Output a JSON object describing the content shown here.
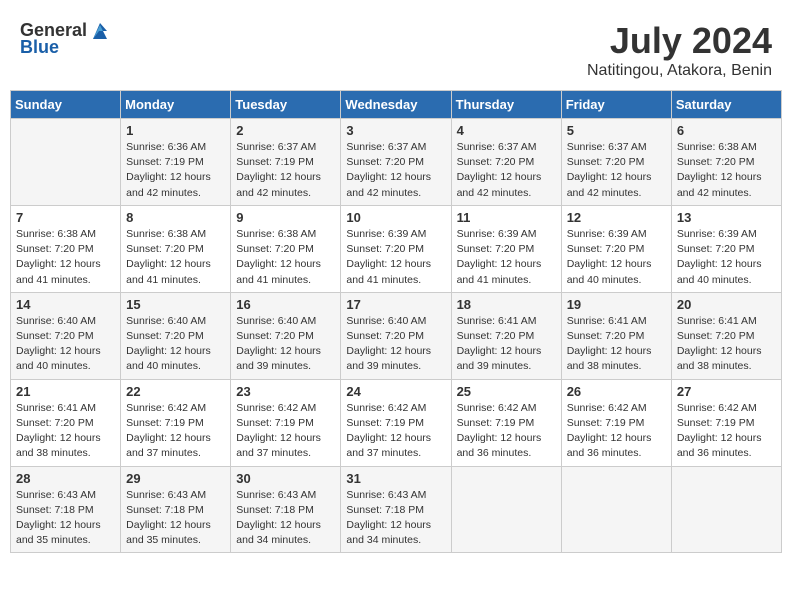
{
  "header": {
    "logo_general": "General",
    "logo_blue": "Blue",
    "title": "July 2024",
    "subtitle": "Natitingou, Atakora, Benin"
  },
  "weekdays": [
    "Sunday",
    "Monday",
    "Tuesday",
    "Wednesday",
    "Thursday",
    "Friday",
    "Saturday"
  ],
  "weeks": [
    [
      {
        "day": "",
        "info": ""
      },
      {
        "day": "1",
        "info": "Sunrise: 6:36 AM\nSunset: 7:19 PM\nDaylight: 12 hours\nand 42 minutes."
      },
      {
        "day": "2",
        "info": "Sunrise: 6:37 AM\nSunset: 7:19 PM\nDaylight: 12 hours\nand 42 minutes."
      },
      {
        "day": "3",
        "info": "Sunrise: 6:37 AM\nSunset: 7:20 PM\nDaylight: 12 hours\nand 42 minutes."
      },
      {
        "day": "4",
        "info": "Sunrise: 6:37 AM\nSunset: 7:20 PM\nDaylight: 12 hours\nand 42 minutes."
      },
      {
        "day": "5",
        "info": "Sunrise: 6:37 AM\nSunset: 7:20 PM\nDaylight: 12 hours\nand 42 minutes."
      },
      {
        "day": "6",
        "info": "Sunrise: 6:38 AM\nSunset: 7:20 PM\nDaylight: 12 hours\nand 42 minutes."
      }
    ],
    [
      {
        "day": "7",
        "info": "Sunrise: 6:38 AM\nSunset: 7:20 PM\nDaylight: 12 hours\nand 41 minutes."
      },
      {
        "day": "8",
        "info": "Sunrise: 6:38 AM\nSunset: 7:20 PM\nDaylight: 12 hours\nand 41 minutes."
      },
      {
        "day": "9",
        "info": "Sunrise: 6:38 AM\nSunset: 7:20 PM\nDaylight: 12 hours\nand 41 minutes."
      },
      {
        "day": "10",
        "info": "Sunrise: 6:39 AM\nSunset: 7:20 PM\nDaylight: 12 hours\nand 41 minutes."
      },
      {
        "day": "11",
        "info": "Sunrise: 6:39 AM\nSunset: 7:20 PM\nDaylight: 12 hours\nand 41 minutes."
      },
      {
        "day": "12",
        "info": "Sunrise: 6:39 AM\nSunset: 7:20 PM\nDaylight: 12 hours\nand 40 minutes."
      },
      {
        "day": "13",
        "info": "Sunrise: 6:39 AM\nSunset: 7:20 PM\nDaylight: 12 hours\nand 40 minutes."
      }
    ],
    [
      {
        "day": "14",
        "info": "Sunrise: 6:40 AM\nSunset: 7:20 PM\nDaylight: 12 hours\nand 40 minutes."
      },
      {
        "day": "15",
        "info": "Sunrise: 6:40 AM\nSunset: 7:20 PM\nDaylight: 12 hours\nand 40 minutes."
      },
      {
        "day": "16",
        "info": "Sunrise: 6:40 AM\nSunset: 7:20 PM\nDaylight: 12 hours\nand 39 minutes."
      },
      {
        "day": "17",
        "info": "Sunrise: 6:40 AM\nSunset: 7:20 PM\nDaylight: 12 hours\nand 39 minutes."
      },
      {
        "day": "18",
        "info": "Sunrise: 6:41 AM\nSunset: 7:20 PM\nDaylight: 12 hours\nand 39 minutes."
      },
      {
        "day": "19",
        "info": "Sunrise: 6:41 AM\nSunset: 7:20 PM\nDaylight: 12 hours\nand 38 minutes."
      },
      {
        "day": "20",
        "info": "Sunrise: 6:41 AM\nSunset: 7:20 PM\nDaylight: 12 hours\nand 38 minutes."
      }
    ],
    [
      {
        "day": "21",
        "info": "Sunrise: 6:41 AM\nSunset: 7:20 PM\nDaylight: 12 hours\nand 38 minutes."
      },
      {
        "day": "22",
        "info": "Sunrise: 6:42 AM\nSunset: 7:19 PM\nDaylight: 12 hours\nand 37 minutes."
      },
      {
        "day": "23",
        "info": "Sunrise: 6:42 AM\nSunset: 7:19 PM\nDaylight: 12 hours\nand 37 minutes."
      },
      {
        "day": "24",
        "info": "Sunrise: 6:42 AM\nSunset: 7:19 PM\nDaylight: 12 hours\nand 37 minutes."
      },
      {
        "day": "25",
        "info": "Sunrise: 6:42 AM\nSunset: 7:19 PM\nDaylight: 12 hours\nand 36 minutes."
      },
      {
        "day": "26",
        "info": "Sunrise: 6:42 AM\nSunset: 7:19 PM\nDaylight: 12 hours\nand 36 minutes."
      },
      {
        "day": "27",
        "info": "Sunrise: 6:42 AM\nSunset: 7:19 PM\nDaylight: 12 hours\nand 36 minutes."
      }
    ],
    [
      {
        "day": "28",
        "info": "Sunrise: 6:43 AM\nSunset: 7:18 PM\nDaylight: 12 hours\nand 35 minutes."
      },
      {
        "day": "29",
        "info": "Sunrise: 6:43 AM\nSunset: 7:18 PM\nDaylight: 12 hours\nand 35 minutes."
      },
      {
        "day": "30",
        "info": "Sunrise: 6:43 AM\nSunset: 7:18 PM\nDaylight: 12 hours\nand 34 minutes."
      },
      {
        "day": "31",
        "info": "Sunrise: 6:43 AM\nSunset: 7:18 PM\nDaylight: 12 hours\nand 34 minutes."
      },
      {
        "day": "",
        "info": ""
      },
      {
        "day": "",
        "info": ""
      },
      {
        "day": "",
        "info": ""
      }
    ]
  ]
}
